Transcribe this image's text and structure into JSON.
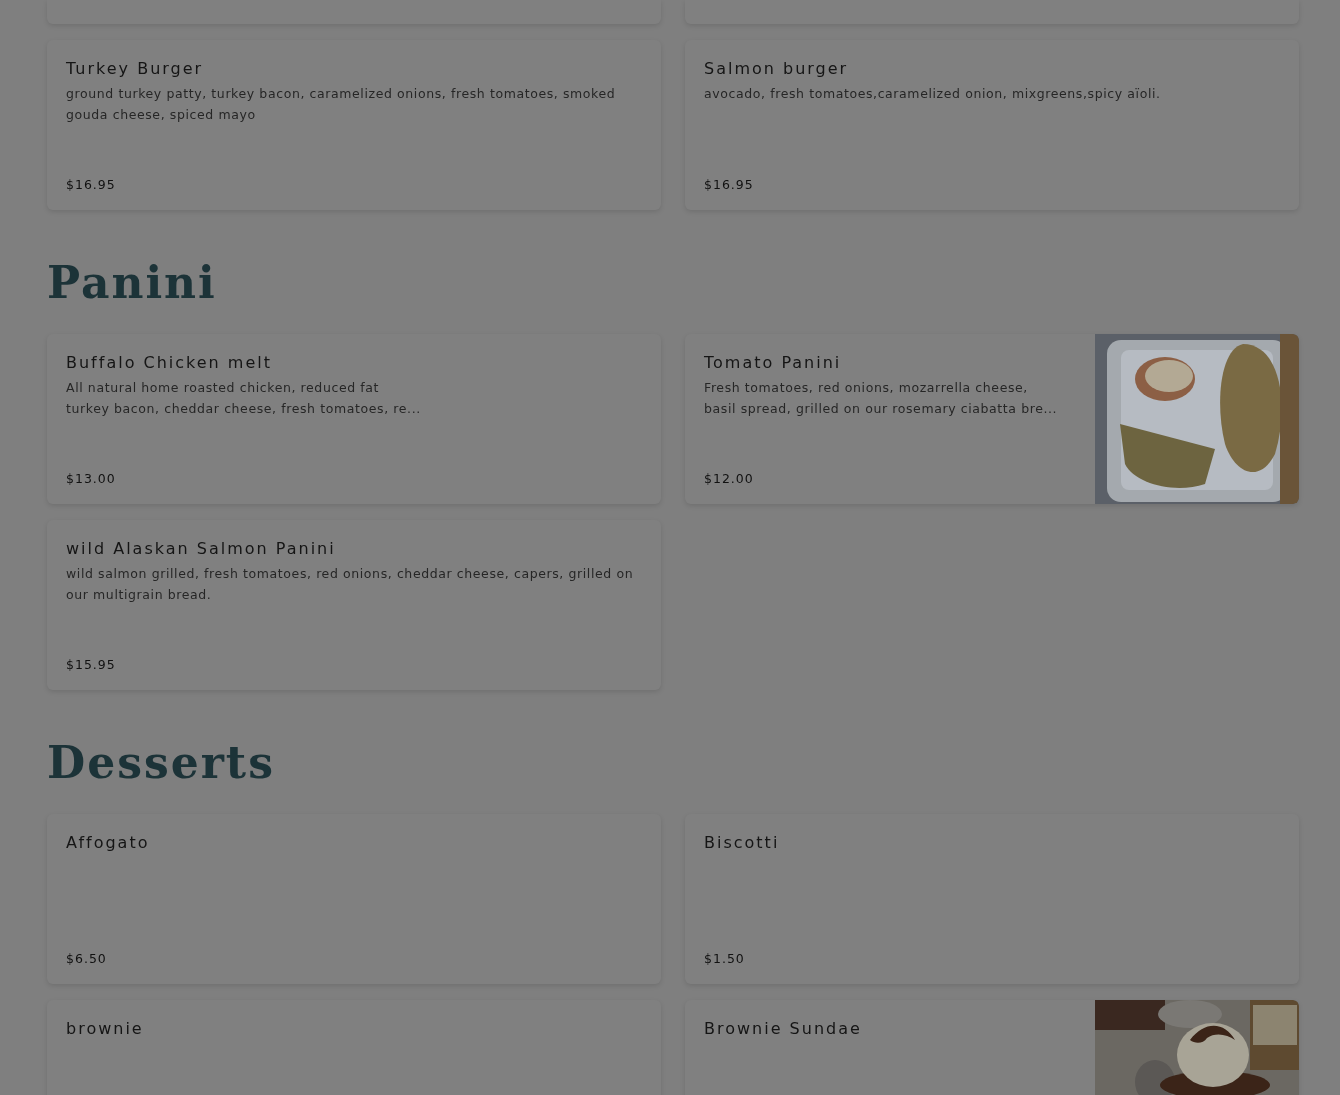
{
  "sections": [
    {
      "items": [
        {
          "name": "Turkey Burger",
          "description": "ground turkey patty, turkey bacon, caramelized onions, fresh tomatoes, smoked gouda cheese, spiced mayo",
          "price": "$16.95"
        },
        {
          "name": "Salmon burger",
          "description": "avocado, fresh tomatoes,caramelized onion, mixgreens,spicy aïoli.",
          "price": "$16.95"
        }
      ]
    },
    {
      "heading": "Panini",
      "items": [
        {
          "name": "Buffalo Chicken melt",
          "description": "All natural home roasted chicken, reduced fat\nturkey bacon, cheddar cheese, fresh tomatoes, re...",
          "price": "$13.00"
        },
        {
          "name": "Tomato Panini",
          "description": "Fresh tomatoes, red onions, mozarrella cheese,\nbasil spread, grilled on our rosemary ciabatta bre...",
          "price": "$12.00"
        },
        {
          "name": "wild Alaskan Salmon Panini",
          "description": "wild salmon grilled, fresh tomatoes, red onions, cheddar cheese, capers, grilled on our multigrain bread.",
          "price": "$15.95"
        }
      ]
    },
    {
      "heading": "Desserts",
      "items": [
        {
          "name": "Affogato",
          "price": "$6.50"
        },
        {
          "name": "Biscotti",
          "price": "$1.50"
        },
        {
          "name": "brownie"
        },
        {
          "name": "Brownie Sundae"
        }
      ]
    }
  ]
}
